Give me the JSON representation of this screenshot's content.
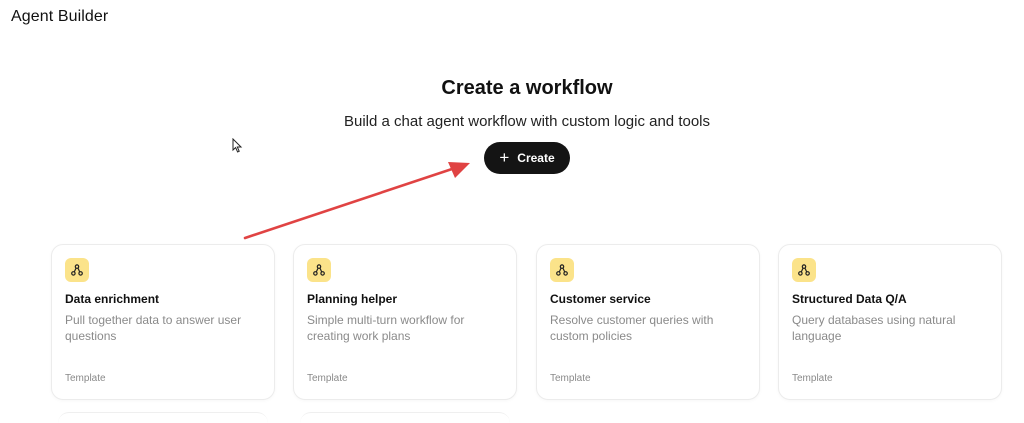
{
  "app": {
    "title": "Agent Builder"
  },
  "hero": {
    "title": "Create a workflow",
    "subtitle": "Build a chat agent workflow with custom logic and tools",
    "create_button": {
      "icon": "plus-icon",
      "label": "Create"
    }
  },
  "colors": {
    "button_bg": "#141414",
    "icon_badge_bg": "#fbe38a",
    "arrow": "#e04343"
  },
  "templates": [
    {
      "title": "Data enrichment",
      "description": "Pull together data to answer user questions",
      "tag": "Template",
      "icon": "workflow-icon"
    },
    {
      "title": "Planning helper",
      "description": "Simple multi-turn workflow for creating work plans",
      "tag": "Template",
      "icon": "workflow-icon"
    },
    {
      "title": "Customer service",
      "description": "Resolve customer queries with custom policies",
      "tag": "Template",
      "icon": "workflow-icon"
    },
    {
      "title": "Structured Data Q/A",
      "description": "Query databases using natural language",
      "tag": "Template",
      "icon": "workflow-icon"
    }
  ]
}
